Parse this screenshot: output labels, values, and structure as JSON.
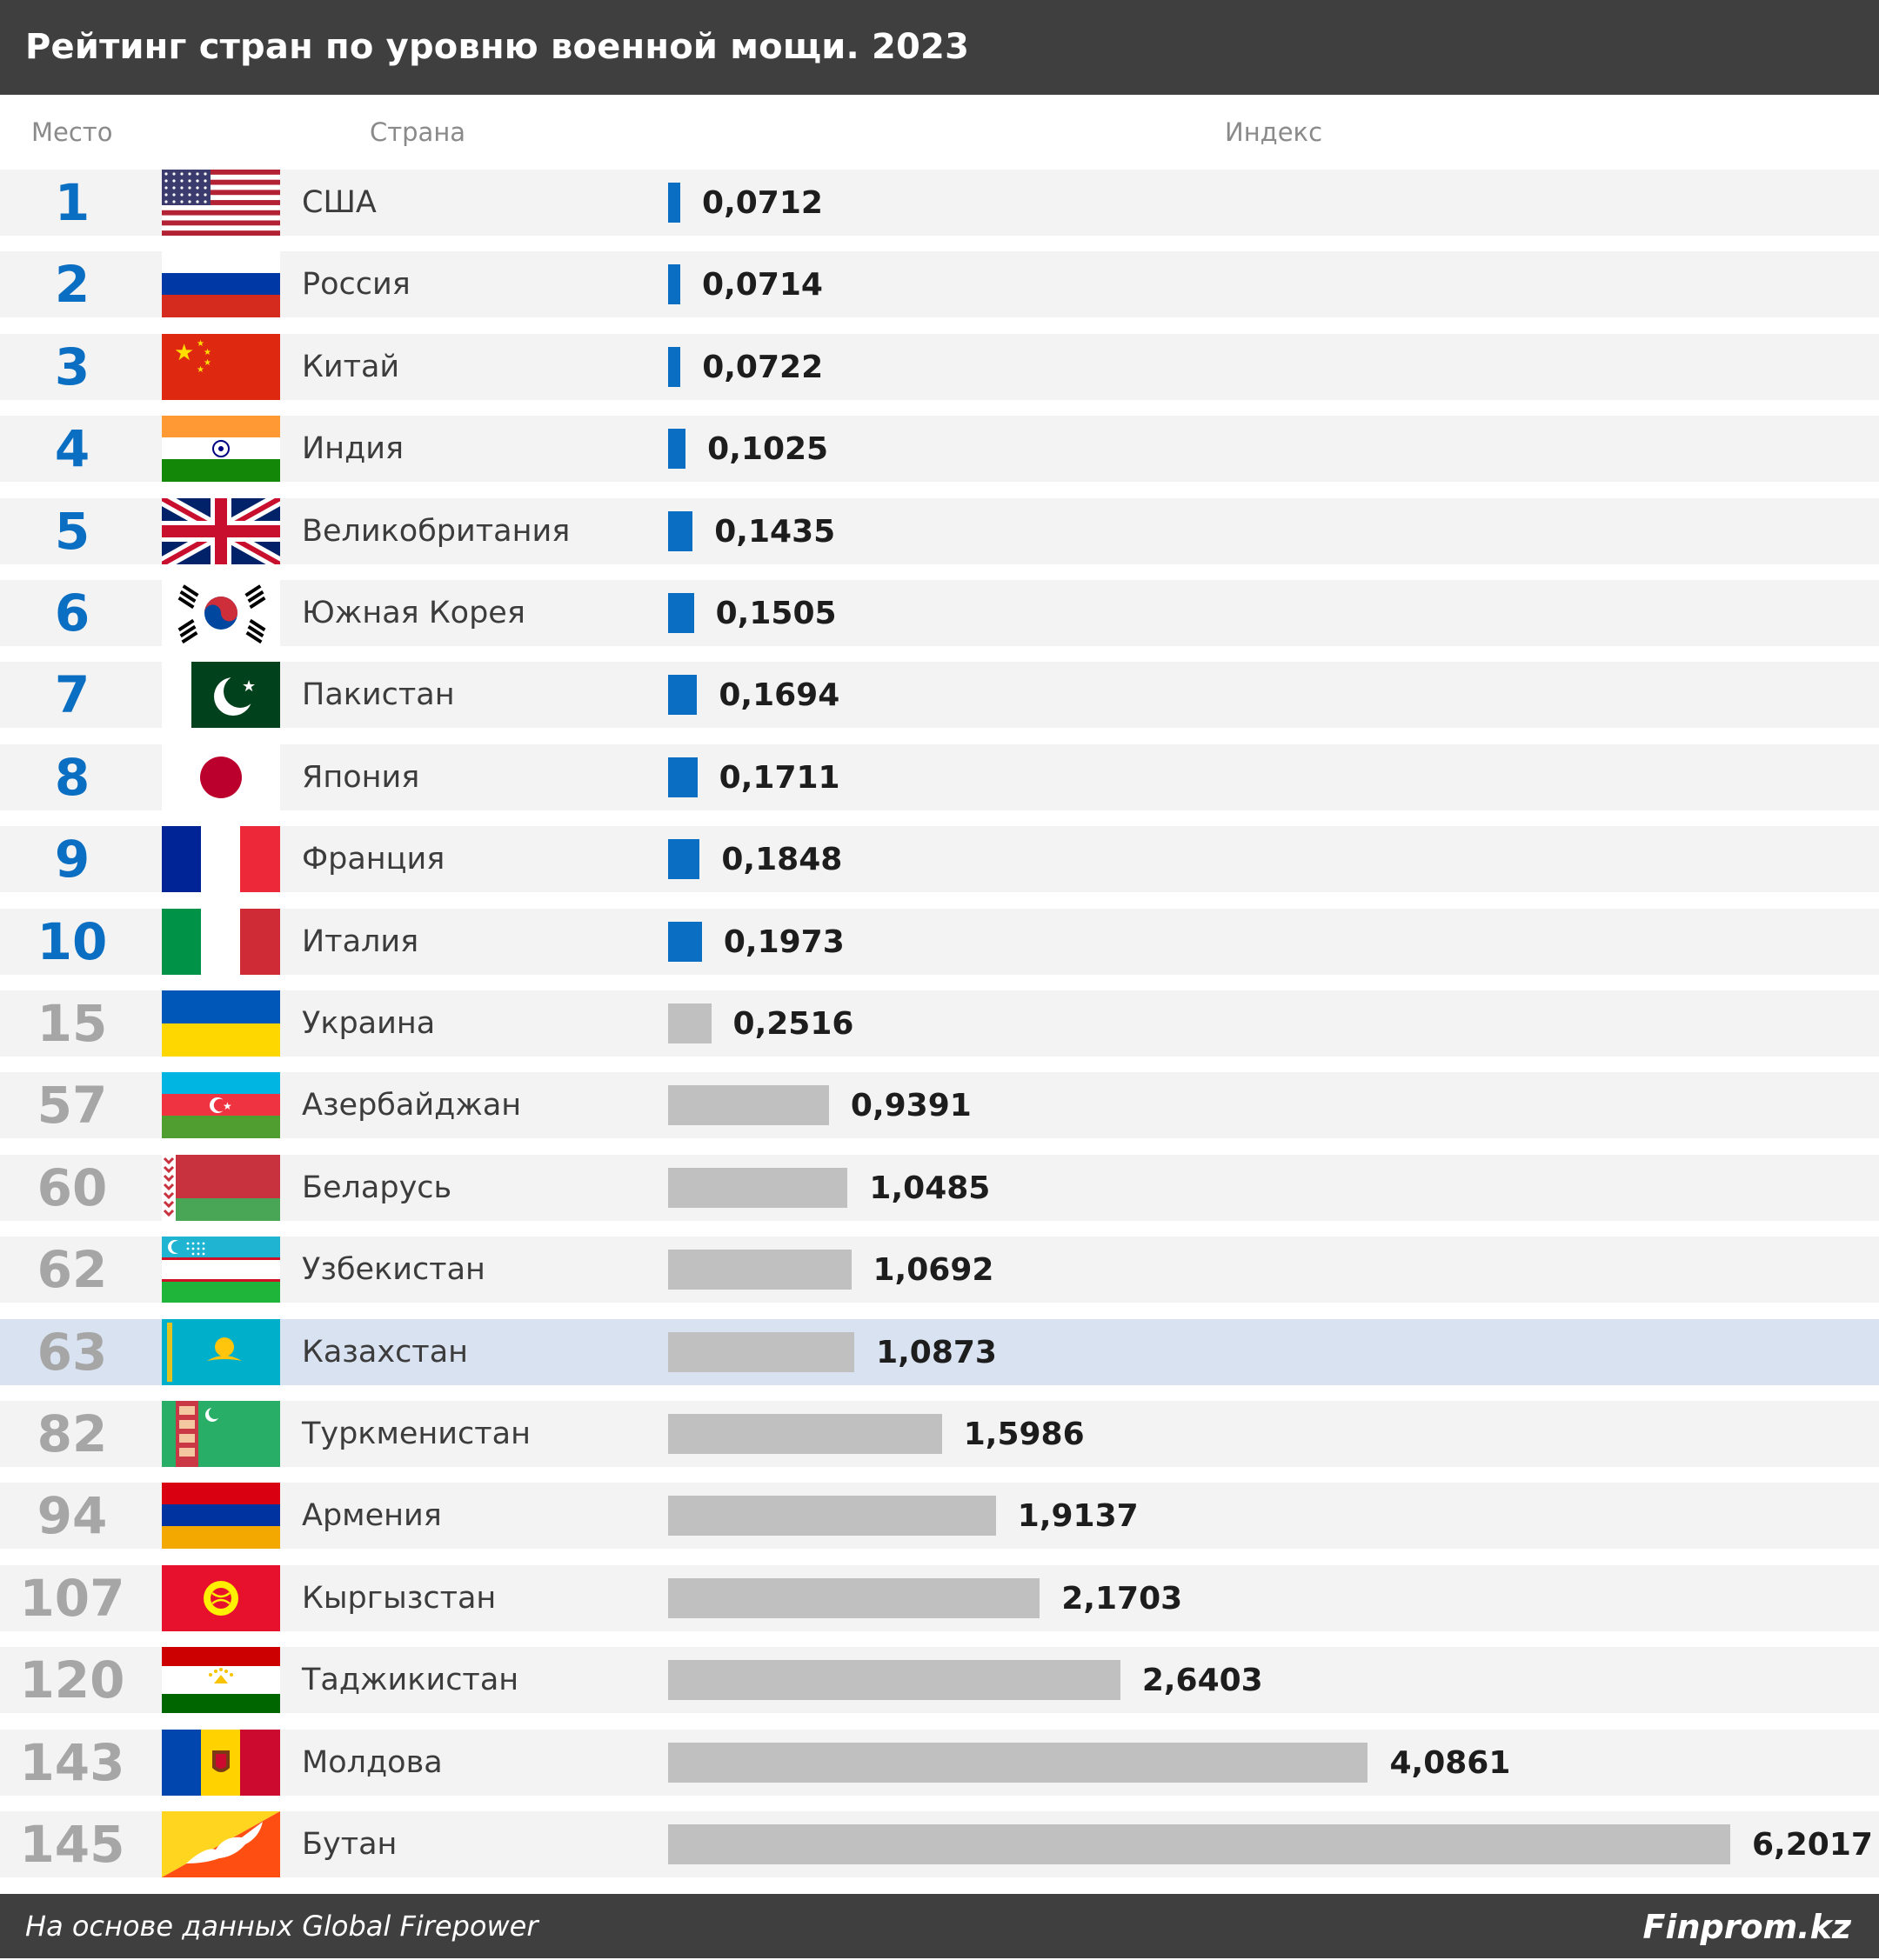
{
  "header": {
    "title": "Рейтинг стран по уровню военной мощи. 2023"
  },
  "columns": {
    "rank": "Место",
    "country": "Страна",
    "index": "Индекс"
  },
  "footer": {
    "source": "На основе данных Global Firepower",
    "brand": "Finprom.kz"
  },
  "colors": {
    "top10": "#0a6ec2",
    "other_rank": "#a6a6a6",
    "other_bar": "#c0c0c0",
    "highlight_row": "#d9e2f1"
  },
  "chart_data": {
    "type": "bar",
    "orientation": "horizontal",
    "title": "Рейтинг стран по уровню военной мощи. 2023",
    "columns": [
      "Место",
      "Страна",
      "Индекс"
    ],
    "highlighted": "Казахстан",
    "rows": [
      {
        "rank": "1",
        "country": "США",
        "value": 0.0712,
        "label": "0,0712",
        "flag": "us-flag",
        "top10": true
      },
      {
        "rank": "2",
        "country": "Россия",
        "value": 0.0714,
        "label": "0,0714",
        "flag": "russia-flag",
        "top10": true
      },
      {
        "rank": "3",
        "country": "Китай",
        "value": 0.0722,
        "label": "0,0722",
        "flag": "china-flag",
        "top10": true
      },
      {
        "rank": "4",
        "country": "Индия",
        "value": 0.1025,
        "label": "0,1025",
        "flag": "india-flag",
        "top10": true
      },
      {
        "rank": "5",
        "country": "Великобритания",
        "value": 0.1435,
        "label": "0,1435",
        "flag": "uk-flag",
        "top10": true
      },
      {
        "rank": "6",
        "country": "Южная Корея",
        "value": 0.1505,
        "label": "0,1505",
        "flag": "south-korea-flag",
        "top10": true
      },
      {
        "rank": "7",
        "country": "Пакистан",
        "value": 0.1694,
        "label": "0,1694",
        "flag": "pakistan-flag",
        "top10": true
      },
      {
        "rank": "8",
        "country": "Япония",
        "value": 0.1711,
        "label": "0,1711",
        "flag": "japan-flag",
        "top10": true
      },
      {
        "rank": "9",
        "country": "Франция",
        "value": 0.1848,
        "label": "0,1848",
        "flag": "france-flag",
        "top10": true
      },
      {
        "rank": "10",
        "country": "Италия",
        "value": 0.1973,
        "label": "0,1973",
        "flag": "italy-flag",
        "top10": true
      },
      {
        "rank": "15",
        "country": "Украина",
        "value": 0.2516,
        "label": "0,2516",
        "flag": "ukraine-flag",
        "top10": false
      },
      {
        "rank": "57",
        "country": "Азербайджан",
        "value": 0.9391,
        "label": "0,9391",
        "flag": "azerbaijan-flag",
        "top10": false
      },
      {
        "rank": "60",
        "country": "Беларусь",
        "value": 1.0485,
        "label": "1,0485",
        "flag": "belarus-flag",
        "top10": false
      },
      {
        "rank": "62",
        "country": "Узбекистан",
        "value": 1.0692,
        "label": "1,0692",
        "flag": "uzbekistan-flag",
        "top10": false
      },
      {
        "rank": "63",
        "country": "Казахстан",
        "value": 1.0873,
        "label": "1,0873",
        "flag": "kazakhstan-flag",
        "top10": false
      },
      {
        "rank": "82",
        "country": "Туркменистан",
        "value": 1.5986,
        "label": "1,5986",
        "flag": "turkmenistan-flag",
        "top10": false
      },
      {
        "rank": "94",
        "country": "Армения",
        "value": 1.9137,
        "label": "1,9137",
        "flag": "armenia-flag",
        "top10": false
      },
      {
        "rank": "107",
        "country": "Кыргызстан",
        "value": 2.1703,
        "label": "2,1703",
        "flag": "kyrgyzstan-flag",
        "top10": false
      },
      {
        "rank": "120",
        "country": "Таджикистан",
        "value": 2.6403,
        "label": "2,6403",
        "flag": "tajikistan-flag",
        "top10": false
      },
      {
        "rank": "143",
        "country": "Молдова",
        "value": 4.0861,
        "label": "4,0861",
        "flag": "moldova-flag",
        "top10": false
      },
      {
        "rank": "145",
        "country": "Бутан",
        "value": 6.2017,
        "label": "6,2017",
        "flag": "bhutan-flag",
        "top10": false
      }
    ]
  }
}
